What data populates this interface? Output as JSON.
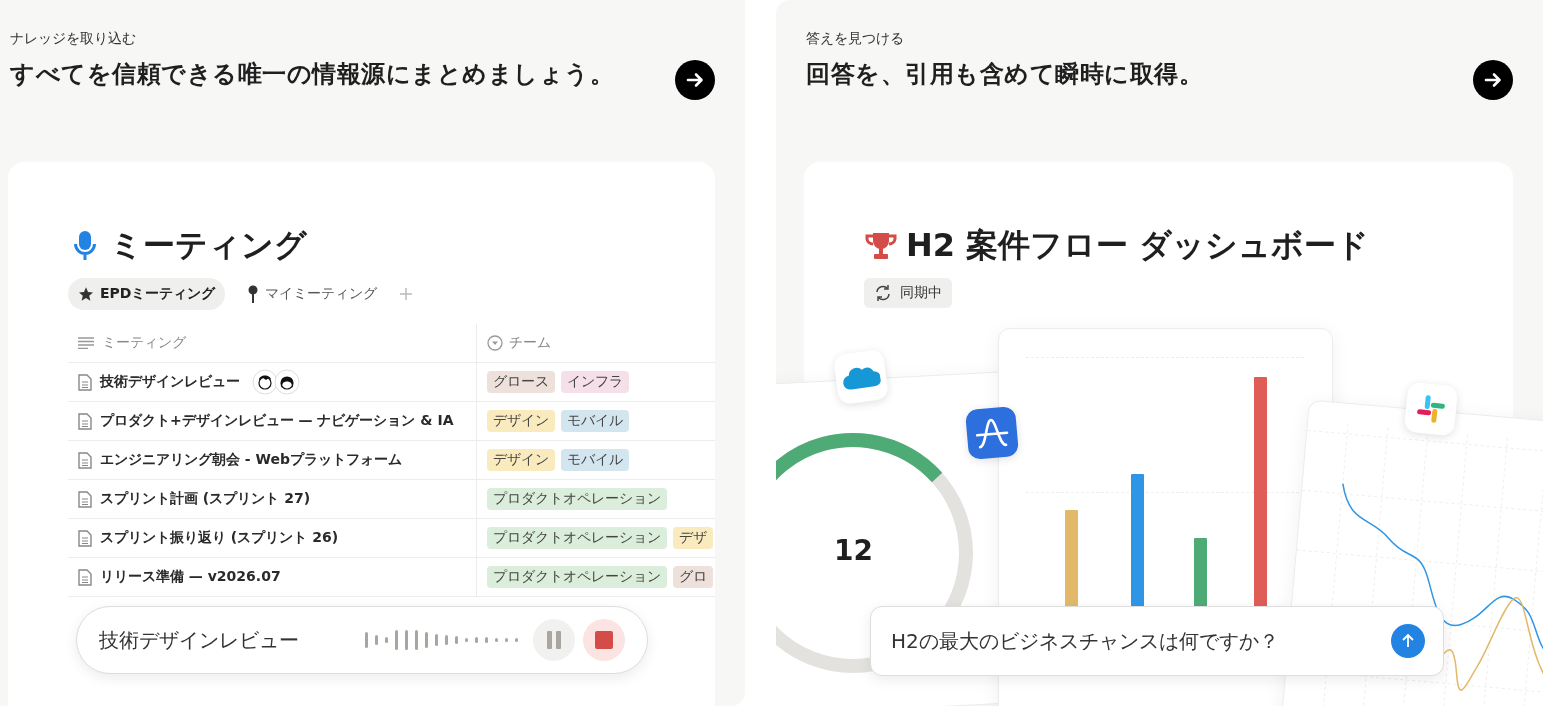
{
  "panels": [
    {
      "eyebrow": "ナレッジを取り込む",
      "headline": "すべてを信頼できる唯一の情報源にまとめましょう。"
    },
    {
      "eyebrow": "答えを見つける",
      "headline": "回答を、引用も含めて瞬時に取得。"
    }
  ],
  "meetings": {
    "title": "ミーティング",
    "tabs": [
      {
        "label": "EPDミーティング",
        "selected": true,
        "kind": "star"
      },
      {
        "label": "マイミーティング",
        "selected": false,
        "kind": "pin"
      }
    ],
    "columns": [
      "ミーティング",
      "チーム"
    ],
    "rows": [
      {
        "title": "技術デザインレビュー",
        "avatars": true,
        "tags": [
          {
            "label": "グロース",
            "color": "#eee0da"
          },
          {
            "label": "インフラ",
            "color": "#f5e0e9"
          }
        ]
      },
      {
        "title": "プロダクト+デザインレビュー — ナビゲーション & IA",
        "avatars": false,
        "tags": [
          {
            "label": "デザイン",
            "color": "#f9ebbd"
          },
          {
            "label": "モバイル",
            "color": "#d3e5ef"
          }
        ]
      },
      {
        "title": "エンジニアリング朝会 - Webプラットフォーム",
        "avatars": false,
        "tags": [
          {
            "label": "デザイン",
            "color": "#f9ebbd"
          },
          {
            "label": "モバイル",
            "color": "#d3e5ef"
          }
        ]
      },
      {
        "title": "スプリント計画 (スプリント 27)",
        "avatars": false,
        "tags": [
          {
            "label": "プロダクトオペレーション",
            "color": "#dbeddb"
          }
        ]
      },
      {
        "title": "スプリント振り返り (スプリント 26)",
        "avatars": false,
        "tags": [
          {
            "label": "プロダクトオペレーション",
            "color": "#dbeddb"
          },
          {
            "label": "デザ",
            "color": "#f9ebbd"
          }
        ]
      },
      {
        "title": "リリース準備 — v2026.07",
        "avatars": false,
        "tags": [
          {
            "label": "プロダクトオペレーション",
            "color": "#dbeddb"
          },
          {
            "label": "グロ",
            "color": "#eee0da"
          }
        ]
      }
    ],
    "recorder": {
      "title": "技術デザインレビュー"
    }
  },
  "dashboard": {
    "title": "H2 案件フロー ダッシュボード",
    "badge": "同期中",
    "gauge": {
      "value": "12",
      "level": 0.3
    },
    "prompt": {
      "value": "H2の最大のビジネスチャンスは何ですか？"
    }
  }
}
